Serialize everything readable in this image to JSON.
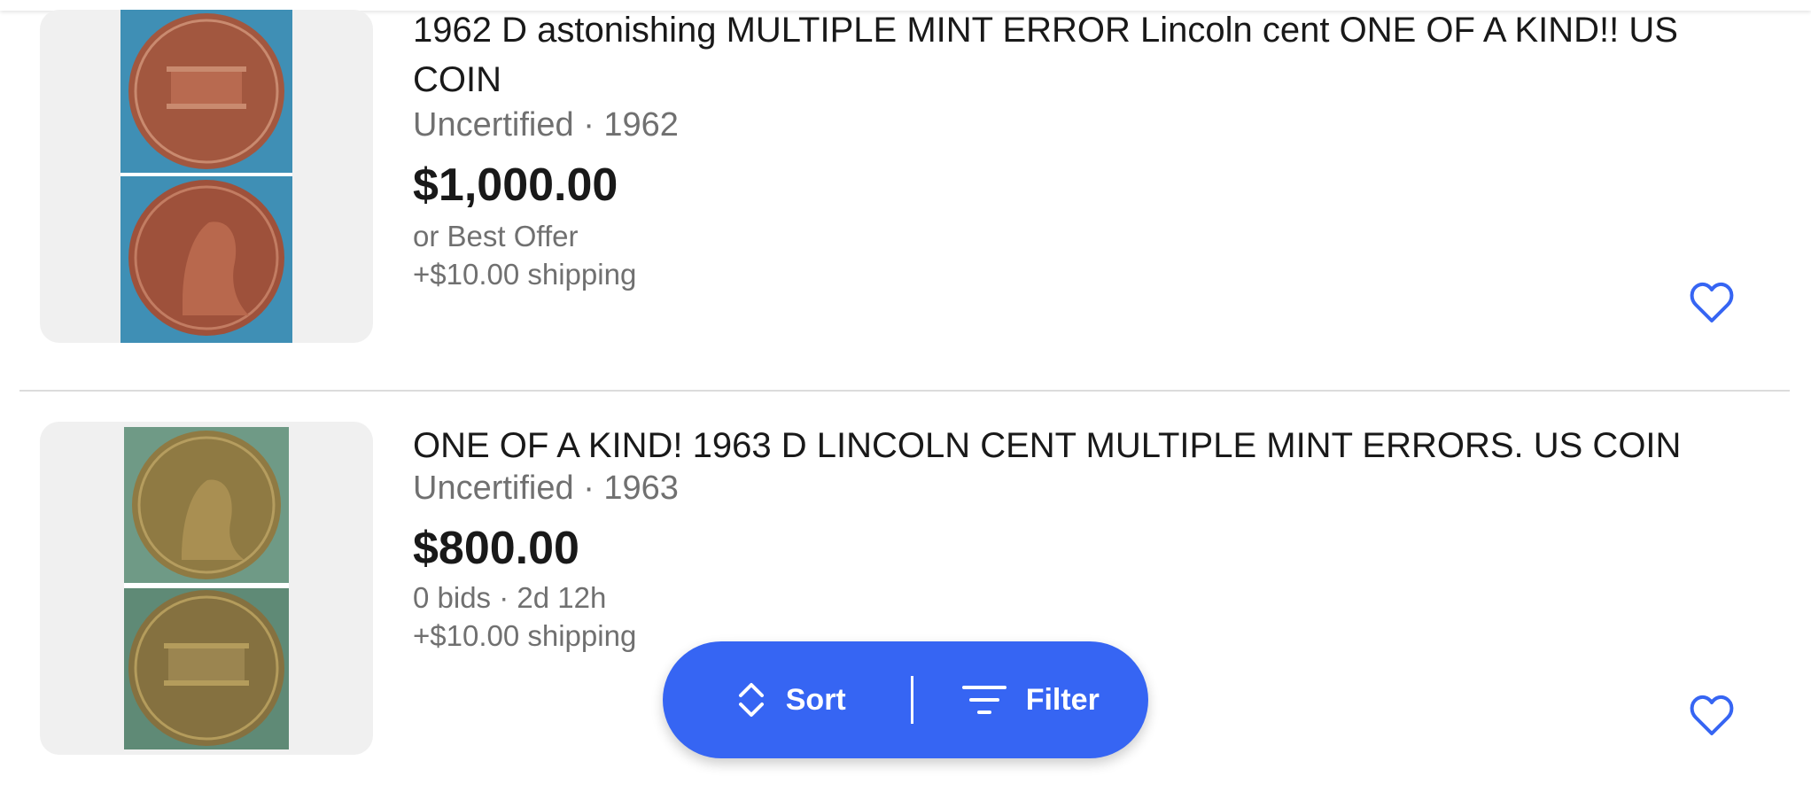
{
  "listings": [
    {
      "title": " 1962 D astonishing  MULTIPLE MINT ERROR Lincoln cent ONE OF A KIND!! US COIN",
      "meta": "Uncertified · 1962",
      "price": "$1,000.00",
      "line1": "or Best Offer",
      "line2": "+$10.00 shipping",
      "image_icon": "coin-photo",
      "favorite_icon": "heart-icon"
    },
    {
      "title": "ONE OF A KIND! 1963 D LINCOLN CENT MULTIPLE MINT ERRORS. US COIN",
      "meta": "Uncertified · 1963",
      "price": "$800.00",
      "line1": "0 bids · 2d 12h",
      "line2": "+$10.00 shipping",
      "image_icon": "coin-photo",
      "favorite_icon": "heart-icon"
    }
  ],
  "actions": {
    "sort_label": "Sort",
    "filter_label": "Filter",
    "sort_icon": "sort-arrows-icon",
    "filter_icon": "filter-lines-icon"
  },
  "colors": {
    "accent": "#3665f3",
    "text_primary": "#191919",
    "text_secondary": "#707070",
    "thumb_bg": "#f0f0f0"
  }
}
